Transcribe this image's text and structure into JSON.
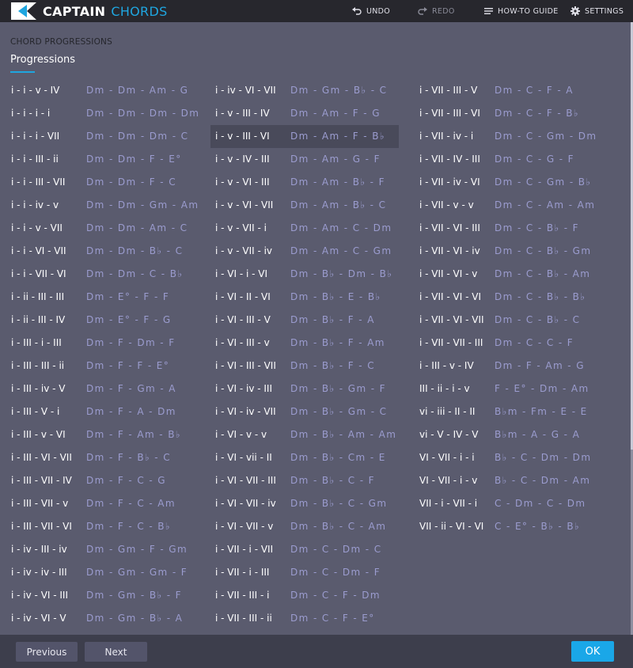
{
  "app": {
    "brand_primary": "CAPTAIN",
    "brand_secondary": "CHORDS",
    "accent_color": "#1fa6e0"
  },
  "nav": {
    "undo": "UNDO",
    "redo": "REDO",
    "guide": "HOW-TO GUIDE",
    "settings": "SETTINGS"
  },
  "header": {
    "section": "CHORD PROGRESSIONS",
    "tab": "Progressions"
  },
  "columns": [
    [
      {
        "roman": "i - i - v - IV",
        "chords": "Dm - Dm - Am - G"
      },
      {
        "roman": "i - i - i - i",
        "chords": "Dm - Dm - Dm - Dm"
      },
      {
        "roman": "i - i - i - VII",
        "chords": "Dm - Dm - Dm - C"
      },
      {
        "roman": "i - i - III - ii",
        "chords": "Dm - Dm - F - E°"
      },
      {
        "roman": "i - i - III - VII",
        "chords": "Dm - Dm - F - C"
      },
      {
        "roman": "i - i - iv - v",
        "chords": "Dm - Dm - Gm - Am"
      },
      {
        "roman": "i - i - v - VII",
        "chords": "Dm - Dm - Am - C"
      },
      {
        "roman": "i - i - VI - VII",
        "chords": "Dm - Dm - B♭ - C"
      },
      {
        "roman": "i - i - VII - VI",
        "chords": "Dm - Dm - C - B♭"
      },
      {
        "roman": "i - ii - III - III",
        "chords": "Dm - E° - F - F"
      },
      {
        "roman": "i - ii - III - IV",
        "chords": "Dm - E° - F - G"
      },
      {
        "roman": "i - III - i - III",
        "chords": "Dm - F - Dm - F"
      },
      {
        "roman": "i - III - III - ii",
        "chords": "Dm - F - F - E°"
      },
      {
        "roman": "i - III - iv - V",
        "chords": "Dm - F - Gm - A"
      },
      {
        "roman": "i - III - V - i",
        "chords": "Dm - F - A - Dm"
      },
      {
        "roman": "i - III - v - VI",
        "chords": "Dm - F - Am - B♭"
      },
      {
        "roman": "i - III - VI - VII",
        "chords": "Dm - F - B♭ - C"
      },
      {
        "roman": "i - III - VII - IV",
        "chords": "Dm - F - C - G"
      },
      {
        "roman": "i - III - VII - v",
        "chords": "Dm - F - C - Am"
      },
      {
        "roman": "i - III - VII - VI",
        "chords": "Dm - F - C - B♭"
      },
      {
        "roman": "i - iv - III - iv",
        "chords": "Dm - Gm - F - Gm"
      },
      {
        "roman": "i - iv - iv - III",
        "chords": "Dm - Gm - Gm - F"
      },
      {
        "roman": "i - iv - VI - III",
        "chords": "Dm - Gm - B♭ - F"
      },
      {
        "roman": "i - iv - VI - V",
        "chords": "Dm - Gm - B♭ - A"
      }
    ],
    [
      {
        "roman": "i - iv - VI - VII",
        "chords": "Dm - Gm - B♭ - C"
      },
      {
        "roman": "i - v - III - IV",
        "chords": "Dm - Am - F - G"
      },
      {
        "roman": "i - v - III - VI",
        "chords": "Dm - Am - F - B♭",
        "selected": true
      },
      {
        "roman": "i - v - IV - III",
        "chords": "Dm - Am - G - F"
      },
      {
        "roman": "i - v - VI - III",
        "chords": "Dm - Am - B♭ - F"
      },
      {
        "roman": "i - v - VI - VII",
        "chords": "Dm - Am - B♭ - C"
      },
      {
        "roman": "i - v - VII - i",
        "chords": "Dm - Am - C - Dm"
      },
      {
        "roman": "i - v - VII - iv",
        "chords": "Dm - Am - C - Gm"
      },
      {
        "roman": "i - VI - i - VI",
        "chords": "Dm - B♭ - Dm - B♭"
      },
      {
        "roman": "i - VI - II - VI",
        "chords": "Dm - B♭ - E - B♭"
      },
      {
        "roman": "i - VI - III - V",
        "chords": "Dm - B♭ - F - A"
      },
      {
        "roman": "i - VI - III - v",
        "chords": "Dm - B♭ - F - Am"
      },
      {
        "roman": "i - VI - III - VII",
        "chords": "Dm - B♭ - F - C"
      },
      {
        "roman": "i - VI - iv - III",
        "chords": "Dm - B♭ - Gm - F"
      },
      {
        "roman": "i - VI - iv - VII",
        "chords": "Dm - B♭ - Gm - C"
      },
      {
        "roman": "i - VI - v - v",
        "chords": "Dm - B♭ - Am - Am"
      },
      {
        "roman": "i - VI - vii - II",
        "chords": "Dm - B♭ - Cm - E"
      },
      {
        "roman": "i - VI - VII - III",
        "chords": "Dm - B♭ - C - F"
      },
      {
        "roman": "i - VI - VII - iv",
        "chords": "Dm - B♭ - C - Gm"
      },
      {
        "roman": "i - VI - VII - v",
        "chords": "Dm - B♭ - C - Am"
      },
      {
        "roman": "i - VII - i - VII",
        "chords": "Dm - C - Dm - C"
      },
      {
        "roman": "i - VII - i - III",
        "chords": "Dm - C - Dm - F"
      },
      {
        "roman": "i - VII - III - i",
        "chords": "Dm - C - F - Dm"
      },
      {
        "roman": "i - VII - III - ii",
        "chords": "Dm - C - F - E°"
      }
    ],
    [
      {
        "roman": "i - VII - III - V",
        "chords": "Dm - C - F - A"
      },
      {
        "roman": "i - VII - III - VI",
        "chords": "Dm - C - F - B♭"
      },
      {
        "roman": "i - VII - iv - i",
        "chords": "Dm - C - Gm - Dm"
      },
      {
        "roman": "i - VII - IV - III",
        "chords": "Dm - C - G - F"
      },
      {
        "roman": "i - VII - iv - VI",
        "chords": "Dm - C - Gm - B♭"
      },
      {
        "roman": "i - VII - v - v",
        "chords": "Dm - C - Am - Am"
      },
      {
        "roman": "i - VII - VI - III",
        "chords": "Dm - C - B♭ - F"
      },
      {
        "roman": "i - VII - VI - iv",
        "chords": "Dm - C - B♭ - Gm"
      },
      {
        "roman": "i - VII - VI - v",
        "chords": "Dm - C - B♭ - Am"
      },
      {
        "roman": "i - VII - VI - VI",
        "chords": "Dm - C - B♭ - B♭"
      },
      {
        "roman": "i - VII - VI - VII",
        "chords": "Dm - C - B♭ - C"
      },
      {
        "roman": "i - VII - VII - III",
        "chords": "Dm - C - C - F"
      },
      {
        "roman": "i - III - v - IV",
        "chords": "Dm - F - Am - G"
      },
      {
        "roman": "III - ii - i - v",
        "chords": "F - E° - Dm - Am"
      },
      {
        "roman": "vi - iii - II - II",
        "chords": "B♭m - Fm - E - E"
      },
      {
        "roman": "vi - V - IV - V",
        "chords": "B♭m - A - G - A"
      },
      {
        "roman": "VI - VII - i - i",
        "chords": "B♭ - C - Dm - Dm"
      },
      {
        "roman": "VI - VII - i - v",
        "chords": "B♭ - C - Dm - Am"
      },
      {
        "roman": "VII - i - VII - i",
        "chords": "C - Dm - C - Dm"
      },
      {
        "roman": "VII - ii - VI - VI",
        "chords": "C - E° - B♭ - B♭"
      }
    ]
  ],
  "footer": {
    "prev": "Previous",
    "next": "Next",
    "ok": "OK"
  }
}
